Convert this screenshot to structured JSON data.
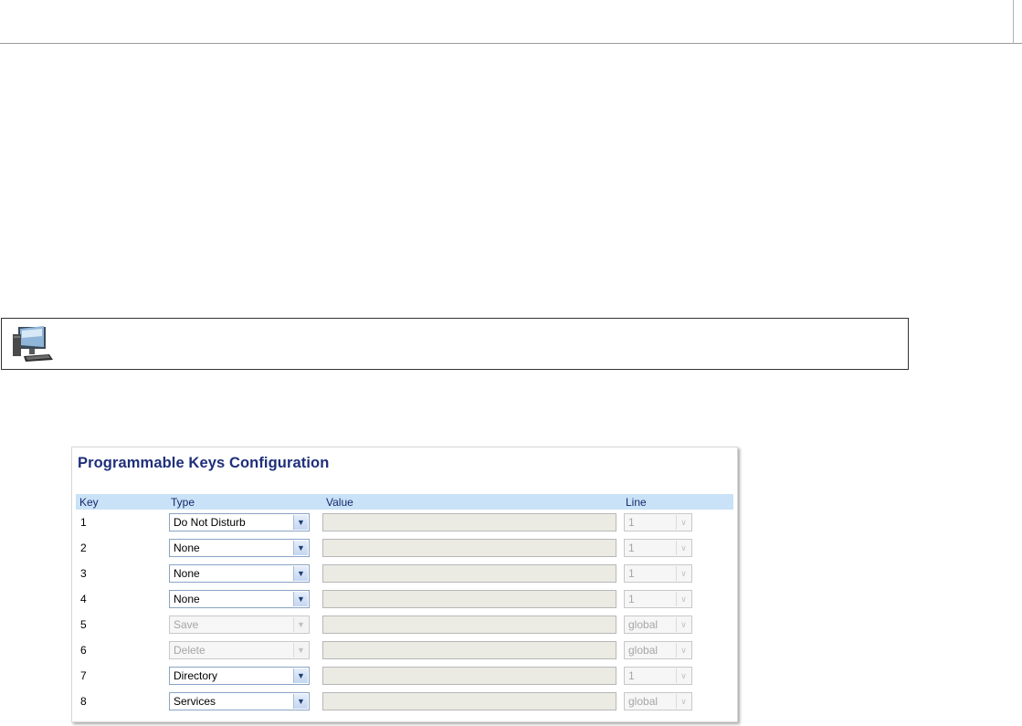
{
  "panel": {
    "title": "Programmable Keys Configuration",
    "columns": {
      "key": "Key",
      "type": "Type",
      "value": "Value",
      "line": "Line"
    },
    "rows": [
      {
        "key": "1",
        "type": "Do Not Disturb",
        "type_enabled": true,
        "value": "",
        "line": "1"
      },
      {
        "key": "2",
        "type": "None",
        "type_enabled": true,
        "value": "",
        "line": "1"
      },
      {
        "key": "3",
        "type": "None",
        "type_enabled": true,
        "value": "",
        "line": "1"
      },
      {
        "key": "4",
        "type": "None",
        "type_enabled": true,
        "value": "",
        "line": "1"
      },
      {
        "key": "5",
        "type": "Save",
        "type_enabled": false,
        "value": "",
        "line": "global"
      },
      {
        "key": "6",
        "type": "Delete",
        "type_enabled": false,
        "value": "",
        "line": "global"
      },
      {
        "key": "7",
        "type": "Directory",
        "type_enabled": true,
        "value": "",
        "line": "1"
      },
      {
        "key": "8",
        "type": "Services",
        "type_enabled": true,
        "value": "",
        "line": "global"
      }
    ]
  },
  "note": {
    "icon": "computer-icon"
  },
  "colors": {
    "title": "#1f2f7a",
    "header_bg": "#c9e2f7",
    "value_field_bg": "#ebebe4"
  }
}
